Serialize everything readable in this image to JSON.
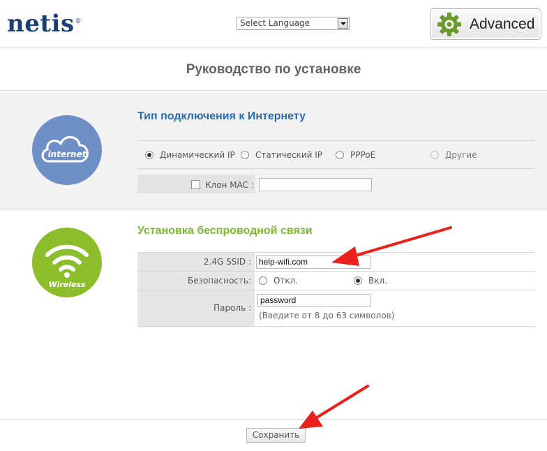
{
  "header": {
    "logo": "netis",
    "logo_mark": "®",
    "language_select": {
      "value": "Select Language"
    },
    "advanced_button": {
      "label": "Advanced",
      "icon": "gear-icon"
    }
  },
  "page_title": "Руководство по установке",
  "internet": {
    "icon_label": "internet",
    "title": "Тип подключения к Интернету",
    "connection_types": [
      {
        "label": "Динамический IP",
        "selected": true
      },
      {
        "label": "Статический IP",
        "selected": false
      },
      {
        "label": "PPPoE",
        "selected": false
      },
      {
        "label": "Другие",
        "selected": false,
        "disabled": true
      }
    ],
    "mac_clone": {
      "label": "Клон MAC :",
      "checked": false,
      "value": ""
    }
  },
  "wireless": {
    "icon_label": "Wireless",
    "title": "Установка беспроводной связи",
    "ssid": {
      "label": "2.4G SSID :",
      "value": "help-wifi.com"
    },
    "security": {
      "label": "Безопасность:",
      "options": [
        {
          "label": "Откл.",
          "selected": false
        },
        {
          "label": "Вкл.",
          "selected": true
        }
      ]
    },
    "password": {
      "label": "Пароль :",
      "value": "password",
      "hint": "(Введите от 8 до 63 символов)"
    }
  },
  "footer": {
    "save_label": "Сохранить"
  },
  "colors": {
    "brand_navy": "#1b3f73",
    "internet_blue": "#6d8fc6",
    "title_blue": "#2a6bb3",
    "wireless_green": "#8cbe2b",
    "title_green": "#7cb82f",
    "annotation_arrow": "#e8221b"
  }
}
